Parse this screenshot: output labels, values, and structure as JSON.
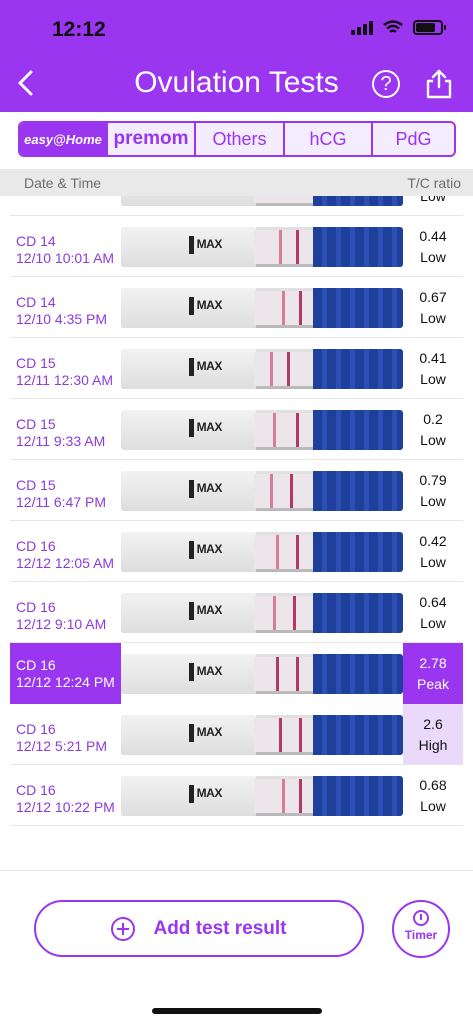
{
  "status": {
    "time": "12:12"
  },
  "header": {
    "title": "Ovulation Tests",
    "help_label": "?"
  },
  "brands": [
    {
      "label": "easy@Home",
      "active": true
    },
    {
      "label": "premom",
      "active": false
    },
    {
      "label": "Others",
      "active": false
    },
    {
      "label": "hCG",
      "active": false
    },
    {
      "label": "PdG",
      "active": false
    }
  ],
  "table": {
    "col_date": "Date & Time",
    "col_ratio": "T/C ratio"
  },
  "rows": [
    {
      "cd": "",
      "date": "",
      "ratio": "",
      "level": "Low",
      "partial": true
    },
    {
      "cd": "CD 14",
      "date": "12/10 10:01 AM",
      "ratio": "0.44",
      "level": "Low"
    },
    {
      "cd": "CD 14",
      "date": "12/10 4:35 PM",
      "ratio": "0.67",
      "level": "Low"
    },
    {
      "cd": "CD 15",
      "date": "12/11 12:30 AM",
      "ratio": "0.41",
      "level": "Low"
    },
    {
      "cd": "CD 15",
      "date": "12/11 9:33 AM",
      "ratio": "0.2",
      "level": "Low"
    },
    {
      "cd": "CD 15",
      "date": "12/11 6:47 PM",
      "ratio": "0.79",
      "level": "Low"
    },
    {
      "cd": "CD 16",
      "date": "12/12 12:05 AM",
      "ratio": "0.42",
      "level": "Low"
    },
    {
      "cd": "CD 16",
      "date": "12/12 9:10 AM",
      "ratio": "0.64",
      "level": "Low"
    },
    {
      "cd": "CD 16",
      "date": "12/12 12:24 PM",
      "ratio": "2.78",
      "level": "Peak",
      "selected": true
    },
    {
      "cd": "CD 16",
      "date": "12/12 5:21 PM",
      "ratio": "2.6",
      "level": "High"
    },
    {
      "cd": "CD 16",
      "date": "12/12 10:22 PM",
      "ratio": "0.68",
      "level": "Low"
    }
  ],
  "strip_label": "MAX",
  "actions": {
    "add_label": "Add test result",
    "timer_label": "Timer"
  },
  "colors": {
    "accent": "#9A35F0",
    "peak_bg": "#9A35F0",
    "high_bg": "#ead9fb"
  }
}
